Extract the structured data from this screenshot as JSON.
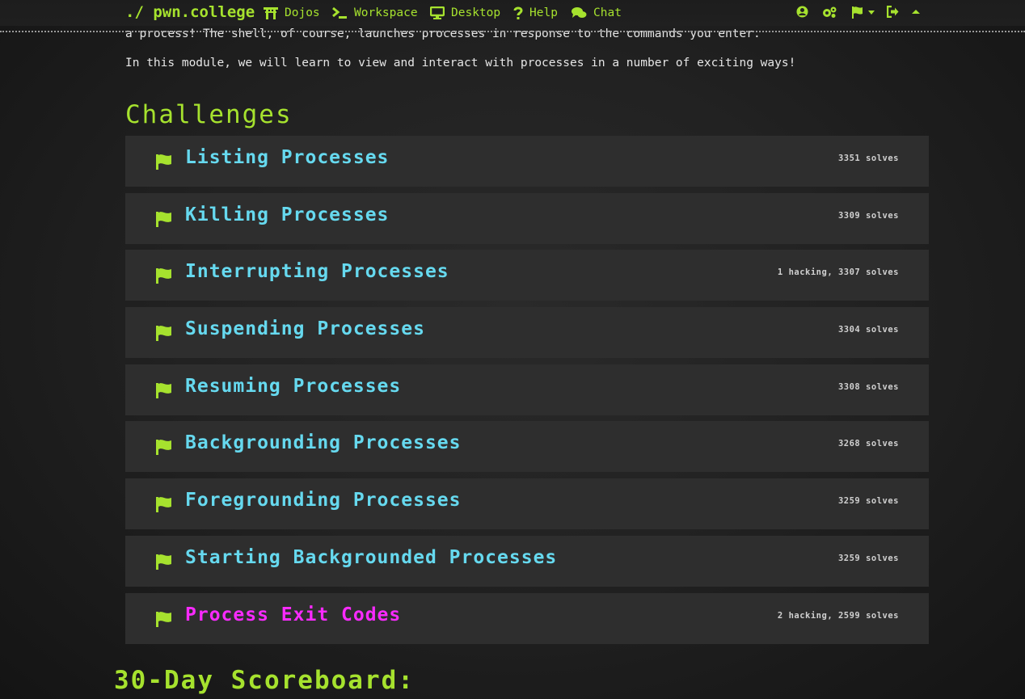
{
  "nav": {
    "brand": "./ pwn.college",
    "items": [
      {
        "label": "Dojos",
        "icon": "torii-gate-icon"
      },
      {
        "label": "Workspace",
        "icon": "terminal-icon"
      },
      {
        "label": "Desktop",
        "icon": "desktop-icon"
      },
      {
        "label": "Help",
        "icon": "question-icon"
      },
      {
        "label": "Chat",
        "icon": "comments-icon"
      }
    ],
    "right_icons": [
      "user-circle-icon",
      "cogs-icon",
      "flag-icon",
      "logout-icon",
      "caret-up-icon"
    ]
  },
  "intro": {
    "line1": "a process! The shell, of course, launches processes in response to the commands you enter.",
    "line2": "In this module, we will learn to view and interact with processes in a number of exciting ways!"
  },
  "challenges_heading": "Challenges",
  "challenges": [
    {
      "title": "Listing Processes",
      "solves": "3351 solves",
      "active": false
    },
    {
      "title": "Killing Processes",
      "solves": "3309 solves",
      "active": false
    },
    {
      "title": "Interrupting Processes",
      "solves": "1 hacking, 3307 solves",
      "active": false
    },
    {
      "title": "Suspending Processes",
      "solves": "3304 solves",
      "active": false
    },
    {
      "title": "Resuming Processes",
      "solves": "3308 solves",
      "active": false
    },
    {
      "title": "Backgrounding Processes",
      "solves": "3268 solves",
      "active": false
    },
    {
      "title": "Foregrounding Processes",
      "solves": "3259 solves",
      "active": false
    },
    {
      "title": "Starting Backgrounded Processes",
      "solves": "3259 solves",
      "active": false
    },
    {
      "title": "Process Exit Codes",
      "solves": "2 hacking, 2599 solves",
      "active": true
    }
  ],
  "scoreboard_heading": "30-Day Scoreboard:",
  "colors": {
    "accent": "#a6e22e",
    "link": "#66d9ef",
    "active": "#f92aff"
  }
}
